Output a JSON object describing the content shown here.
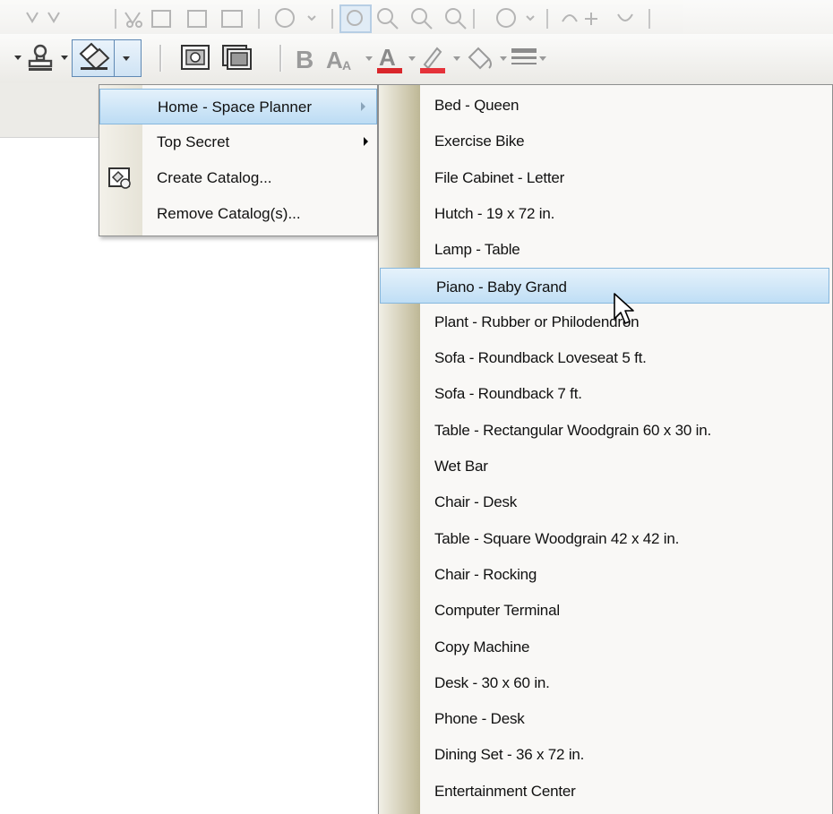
{
  "menu": {
    "catalog_items": [
      {
        "label": "Home - Space Planner",
        "has_submenu": true,
        "highlighted": true,
        "icon": ""
      },
      {
        "label": "Top Secret",
        "has_submenu": true,
        "highlighted": false,
        "icon": ""
      },
      {
        "label": "Create Catalog...",
        "has_submenu": false,
        "highlighted": false,
        "icon": "catalog-icon"
      },
      {
        "label": "Remove Catalog(s)...",
        "has_submenu": false,
        "highlighted": false,
        "icon": ""
      }
    ],
    "submenu_items": [
      "Bed - Queen",
      "Exercise Bike",
      "File Cabinet - Letter",
      "Hutch - 19 x 72 in.",
      "Lamp - Table",
      "Piano - Baby Grand",
      "Plant - Rubber or Philodendron",
      "Sofa - Roundback Loveseat 5 ft.",
      "Sofa - Roundback 7 ft.",
      "Table - Rectangular Woodgrain 60 x 30 in.",
      "Wet Bar",
      "Chair - Desk",
      "Table - Square Woodgrain 42 x 42 in.",
      "Chair - Rocking",
      "Computer Terminal",
      "Copy Machine",
      "Desk - 30 x 60 in.",
      "Phone - Desk",
      "Dining Set - 36 x 72 in.",
      "Entertainment Center"
    ],
    "highlighted_submenu_item": "Piano - Baby Grand"
  },
  "toolbar": {
    "row2_icons": [
      "stamp-icon",
      "catalog-symbol-icon",
      "snapshot-icon",
      "snapshot-copy-icon",
      "bold-icon",
      "font-size-icon",
      "font-color-icon",
      "line-color-icon",
      "fill-color-icon",
      "line-style-icon"
    ]
  },
  "colors": {
    "highlight": "#bcdcf4",
    "highlight_border": "#86b7dd",
    "font_color_bar": "#d9262b",
    "line_color_bar": "#e5323a"
  }
}
